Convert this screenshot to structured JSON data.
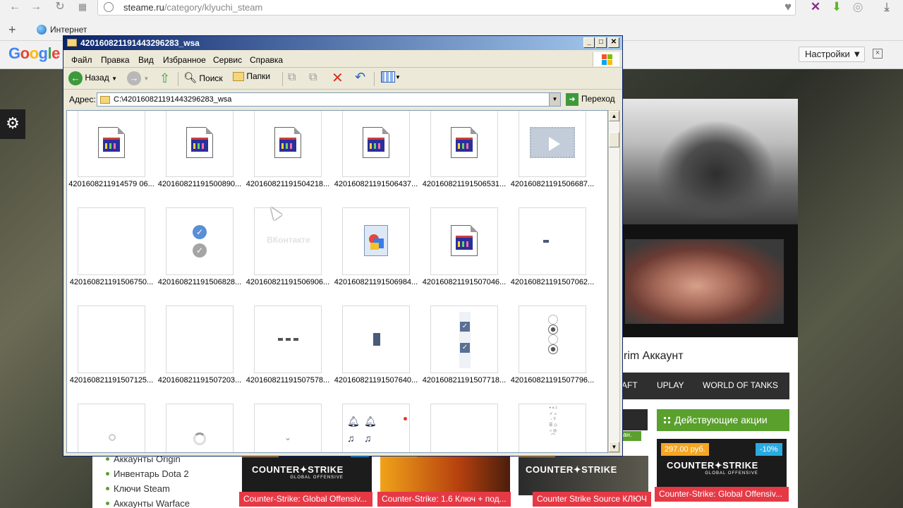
{
  "browser": {
    "url_domain": "steame.ru",
    "url_path": "/category/klyuchi_steam",
    "bookmark_label": "Интернет",
    "new_tab": "+"
  },
  "google_bar": {
    "logo": "Google",
    "settings_label": "Настройки ▼",
    "close": "×"
  },
  "explorer": {
    "title": "420160821191443296283_wsa",
    "menu": [
      "Файл",
      "Правка",
      "Вид",
      "Избранное",
      "Сервис",
      "Справка"
    ],
    "toolbar": {
      "back_label": "Назад",
      "search_label": "Поиск",
      "folders_label": "Папки"
    },
    "address_label": "Адрес:",
    "address_value": "C:\\420160821191443296283_wsa",
    "go_label": "Переход",
    "files": [
      {
        "name": "4201608211914579 06...",
        "kind": "doc"
      },
      {
        "name": "420160821191500890...",
        "kind": "doc"
      },
      {
        "name": "420160821191504218...",
        "kind": "doc"
      },
      {
        "name": "420160821191506437...",
        "kind": "doc"
      },
      {
        "name": "420160821191506531...",
        "kind": "doc"
      },
      {
        "name": "420160821191506687...",
        "kind": "video"
      },
      {
        "name": "420160821191506750...",
        "kind": "blank"
      },
      {
        "name": "420160821191506828...",
        "kind": "checks"
      },
      {
        "name": "420160821191506906...",
        "kind": "vk",
        "thumb_text": "ВКонтакте"
      },
      {
        "name": "420160821191506984...",
        "kind": "paint"
      },
      {
        "name": "420160821191507046...",
        "kind": "doc"
      },
      {
        "name": "420160821191507062...",
        "kind": "dash"
      },
      {
        "name": "420160821191507125...",
        "kind": "blank"
      },
      {
        "name": "420160821191507203...",
        "kind": "blank"
      },
      {
        "name": "420160821191507578...",
        "kind": "dashes"
      },
      {
        "name": "420160821191507640...",
        "kind": "bar"
      },
      {
        "name": "420160821191507718...",
        "kind": "checkboxes"
      },
      {
        "name": "420160821191507796...",
        "kind": "radios"
      },
      {
        "name": "",
        "kind": "search"
      },
      {
        "name": "",
        "kind": "spinner"
      },
      {
        "name": "",
        "kind": "chevron"
      },
      {
        "name": "",
        "kind": "bells"
      },
      {
        "name": "",
        "kind": "blank"
      },
      {
        "name": "",
        "kind": "symbols"
      }
    ]
  },
  "page": {
    "heading": "rim Аккаунт",
    "categories": [
      "AFT",
      "UPLAY",
      "WORLD OF TANKS"
    ],
    "promo_label": "Действующие акции",
    "green_tag": "ан.",
    "feature": {
      "price": "297.00 руб.",
      "discount": "-10%",
      "label": "Counter-Strike: Global Offensiv..."
    },
    "cs_logo": "COUNTER✦STRIKE",
    "cs_sub": "GLOBAL OFFENSIVE",
    "products": [
      "Counter-Strike: Global Offensiv...",
      "Counter-Strike: 1.6 Ключ + под...",
      "Counter Strike Source КЛЮЧ"
    ],
    "side_links": [
      "Аккаунты Origin",
      "Инвентарь Dota 2",
      "Ключи Steam",
      "Аккаунты Warface"
    ]
  },
  "colors": {
    "accent_green": "#5aa02c",
    "badge_orange": "#f5a623",
    "badge_blue": "#29abe2",
    "label_red": "#e63946",
    "xp_title": "#0a246a"
  }
}
